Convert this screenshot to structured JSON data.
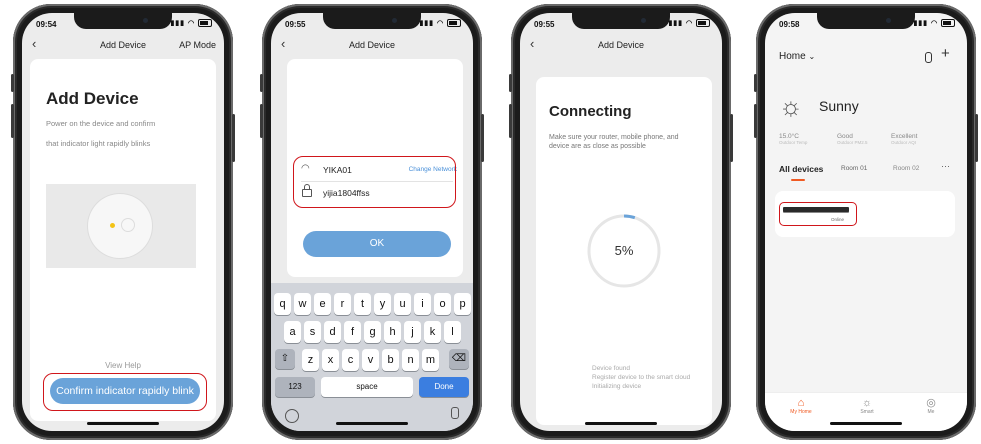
{
  "phone1": {
    "time": "09:54",
    "nav_title": "Add Device",
    "nav_right": "AP Mode",
    "heading": "Add Device",
    "desc_line1": "Power on the device and confirm",
    "desc_line2": "that indicator light rapidly blinks",
    "view_help": "View Help",
    "confirm_button": "Confirm indicator rapidly blink"
  },
  "phone2": {
    "time": "09:55",
    "nav_title": "Add Device",
    "wifi_name": "YIKA01",
    "change_network": "Change Network",
    "password": "yijia1804ffss",
    "ok_button": "OK",
    "keyboard": {
      "row1": [
        "q",
        "w",
        "e",
        "r",
        "t",
        "y",
        "u",
        "i",
        "o",
        "p"
      ],
      "row2": [
        "a",
        "s",
        "d",
        "f",
        "g",
        "h",
        "j",
        "k",
        "l"
      ],
      "row3": [
        "z",
        "x",
        "c",
        "v",
        "b",
        "n",
        "m"
      ],
      "numbers_key": "123",
      "space_key": "space",
      "done_key": "Done"
    }
  },
  "phone3": {
    "time": "09:55",
    "nav_title": "Add Device",
    "heading": "Connecting",
    "desc": "Make sure your router, mobile phone, and device are as close as possible",
    "progress_text": "5%",
    "progress_value": 0.05,
    "steps": [
      "Device found",
      "Register device to the smart cloud",
      "Initializing device"
    ]
  },
  "phone4": {
    "time": "09:58",
    "home_label": "Home",
    "weather": "Sunny",
    "stats": [
      {
        "value": "15.0°C",
        "label": "Outdoor Temp"
      },
      {
        "value": "Good",
        "label": "Outdoor PM2.5"
      },
      {
        "value": "Excellent",
        "label": "Outdoor AQI"
      }
    ],
    "tabs": [
      "All devices",
      "Room 01",
      "Room 02"
    ],
    "device_status": "Online",
    "bottom_nav": [
      "My Home",
      "Smart",
      "Me"
    ]
  },
  "colors": {
    "accent_blue": "#6aa3d9",
    "highlight_red": "#d0161b",
    "tab_orange": "#f05a22"
  }
}
